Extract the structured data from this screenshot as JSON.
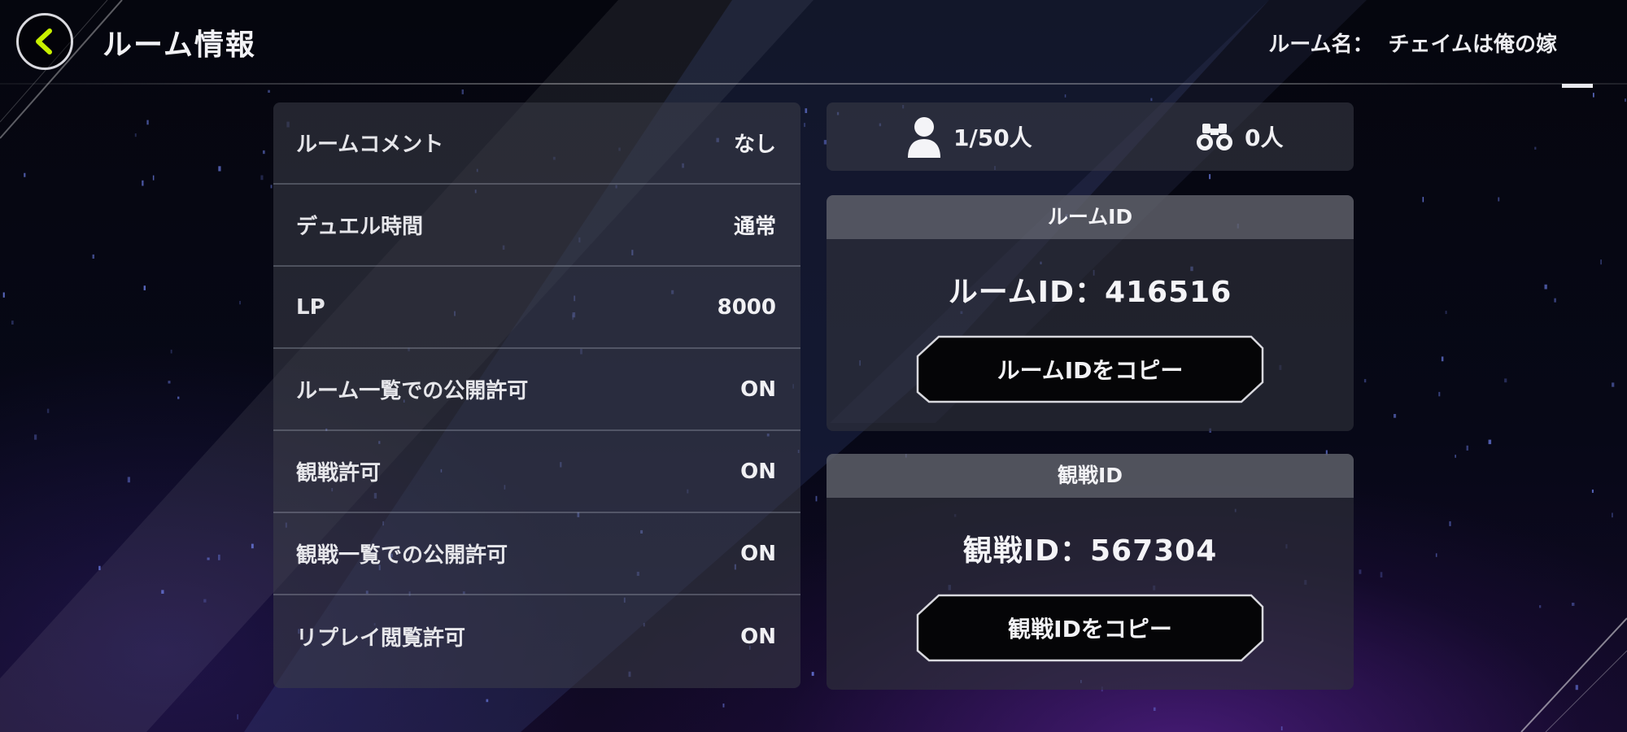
{
  "header": {
    "title": "ルーム情報",
    "room_name_label": "ルーム名：",
    "room_name_value": "チェイムは俺の嫁"
  },
  "settings": [
    {
      "label": "ルームコメント",
      "value": "なし"
    },
    {
      "label": "デュエル時間",
      "value": "通常"
    },
    {
      "label": "LP",
      "value": "8000"
    },
    {
      "label": "ルーム一覧での公開許可",
      "value": "ON"
    },
    {
      "label": "観戦許可",
      "value": "ON"
    },
    {
      "label": "観戦一覧での公開許可",
      "value": "ON"
    },
    {
      "label": "リプレイ閲覧許可",
      "value": "ON"
    }
  ],
  "counts": {
    "players": "1/50人",
    "spectators": "0人"
  },
  "room_id_card": {
    "header": "ルームID",
    "display": "ルームID：416516",
    "copy_button": "ルームIDをコピー"
  },
  "spectate_id_card": {
    "header": "観戦ID",
    "display": "観戦ID：567304",
    "copy_button": "観戦IDをコピー"
  },
  "colors": {
    "back_arrow": "#c8f000",
    "panel_bg": "#3c3e48",
    "accent_purple": "#6e28b4"
  },
  "icons": {
    "back": "chevron-left-icon",
    "players": "person-icon",
    "spectators": "binoculars-icon"
  }
}
